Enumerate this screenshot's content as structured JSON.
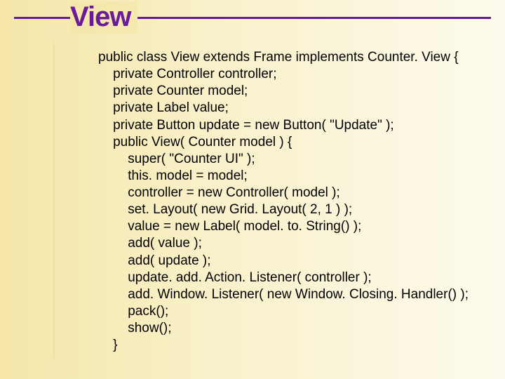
{
  "title": "View",
  "code_lines": [
    "public class View extends Frame implements Counter. View {",
    "    private Controller controller;",
    "    private Counter model;",
    "    private Label value;",
    "    private Button update = new Button( \"Update\" );",
    "    public View( Counter model ) {",
    "        super( \"Counter UI\" );",
    "        this. model = model;",
    "        controller = new Controller( model );",
    "        set. Layout( new Grid. Layout( 2, 1 ) );",
    "        value = new Label( model. to. String() );",
    "        add( value );",
    "        add( update );",
    "        update. add. Action. Listener( controller );",
    "        add. Window. Listener( new Window. Closing. Handler() );",
    "        pack();",
    "        show();",
    "    }"
  ]
}
